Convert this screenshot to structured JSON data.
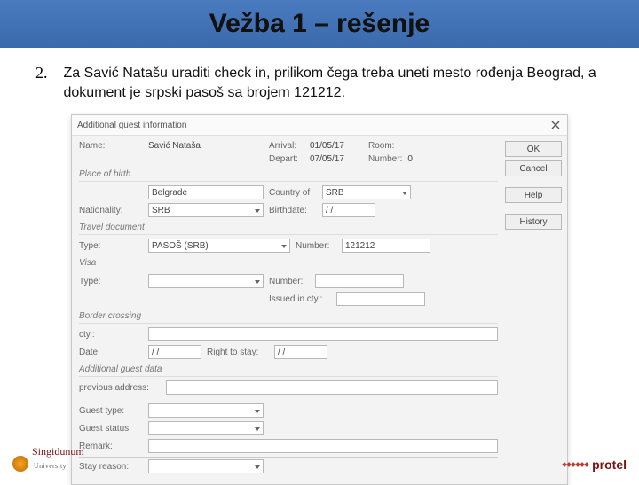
{
  "title": "Vežba 1 – rešenje",
  "q": {
    "num": "2.",
    "text": "Za Savić Natašu uraditi check in, prilikom čega treba uneti mesto rođenja Beograd, a dokument je srpski pasoš sa brojem 121212."
  },
  "dialog": {
    "title": "Additional guest information",
    "buttons": {
      "ok": "OK",
      "cancel": "Cancel",
      "help": "Help",
      "history": "History"
    },
    "top": {
      "name_lbl": "Name:",
      "name_val": "Savić Nataša",
      "arr_lbl": "Arrival:",
      "arr_val": "01/05/17",
      "dep_lbl": "Depart:",
      "dep_val": "07/05/17",
      "room_lbl": "Room:",
      "room_val": "",
      "num_lbl": "Number:",
      "num_val": "0"
    },
    "birth": {
      "section": "Place of birth",
      "place_val": "Belgrade",
      "country_lbl": "Country of",
      "country_val": "SRB",
      "nat_lbl": "Nationality:",
      "nat_val": "SRB",
      "birth_lbl": "Birthdate:",
      "birth_val": "/  /"
    },
    "doc": {
      "section": "Travel document",
      "type_lbl": "Type:",
      "type_val": "PASOŠ (SRB)",
      "num_lbl": "Number:",
      "num_val": "121212"
    },
    "visa": {
      "section": "Visa",
      "type_lbl": "Type:",
      "num_lbl": "Number:",
      "issued_lbl": "Issued in cty.:"
    },
    "border": {
      "section": "Border crossing",
      "city_lbl": "cty.:",
      "date_lbl": "Date:",
      "date_val": "/  /",
      "rts_lbl": "Right to stay:",
      "rts_val": "/  /"
    },
    "add": {
      "section": "Additional guest data",
      "prev_lbl": "previous address:",
      "gtype_lbl": "Guest type:",
      "gstat_lbl": "Guest status:",
      "remark_lbl": "Remark:",
      "stay_lbl": "Stay reason:"
    }
  },
  "logos": {
    "s1": "Singidunum",
    "s1sub": "University",
    "p1": "protel"
  }
}
